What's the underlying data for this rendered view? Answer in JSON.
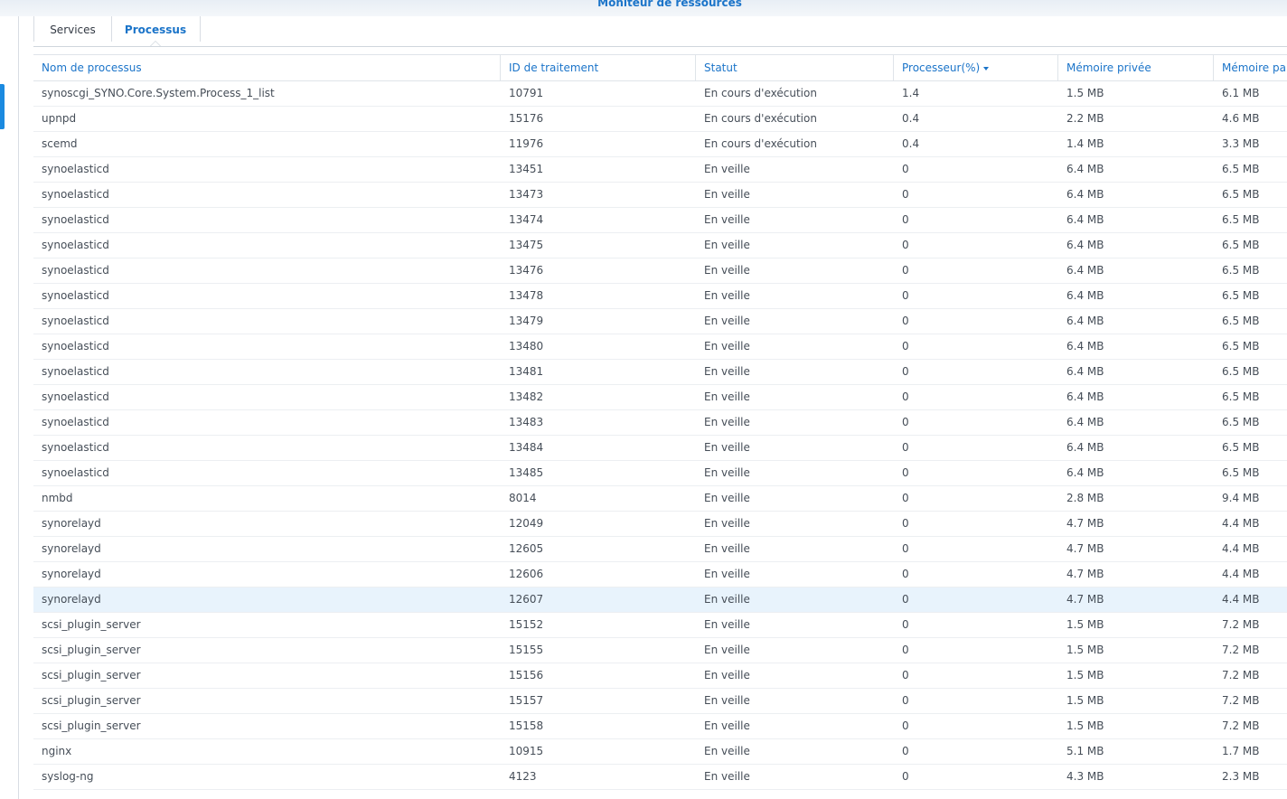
{
  "window": {
    "title": "Moniteur de ressources"
  },
  "tabs": [
    {
      "label": "Services",
      "active": false
    },
    {
      "label": "Processus",
      "active": true
    }
  ],
  "table": {
    "columns": [
      "Nom de processus",
      "ID de traitement",
      "Statut",
      "Processeur(%)",
      "Mémoire privée",
      "Mémoire pa"
    ],
    "sorted_column": "Processeur(%)",
    "sort_direction": "descending",
    "selected_row": 20,
    "rows": [
      [
        "synoscgi_SYNO.Core.System.Process_1_list",
        "10791",
        "En cours d'exécution",
        "1.4",
        "1.5 MB",
        "6.1 MB"
      ],
      [
        "upnpd",
        "15176",
        "En cours d'exécution",
        "0.4",
        "2.2 MB",
        "4.6 MB"
      ],
      [
        "scemd",
        "11976",
        "En cours d'exécution",
        "0.4",
        "1.4 MB",
        "3.3 MB"
      ],
      [
        "synoelasticd",
        "13451",
        "En veille",
        "0",
        "6.4 MB",
        "6.5 MB"
      ],
      [
        "synoelasticd",
        "13473",
        "En veille",
        "0",
        "6.4 MB",
        "6.5 MB"
      ],
      [
        "synoelasticd",
        "13474",
        "En veille",
        "0",
        "6.4 MB",
        "6.5 MB"
      ],
      [
        "synoelasticd",
        "13475",
        "En veille",
        "0",
        "6.4 MB",
        "6.5 MB"
      ],
      [
        "synoelasticd",
        "13476",
        "En veille",
        "0",
        "6.4 MB",
        "6.5 MB"
      ],
      [
        "synoelasticd",
        "13478",
        "En veille",
        "0",
        "6.4 MB",
        "6.5 MB"
      ],
      [
        "synoelasticd",
        "13479",
        "En veille",
        "0",
        "6.4 MB",
        "6.5 MB"
      ],
      [
        "synoelasticd",
        "13480",
        "En veille",
        "0",
        "6.4 MB",
        "6.5 MB"
      ],
      [
        "synoelasticd",
        "13481",
        "En veille",
        "0",
        "6.4 MB",
        "6.5 MB"
      ],
      [
        "synoelasticd",
        "13482",
        "En veille",
        "0",
        "6.4 MB",
        "6.5 MB"
      ],
      [
        "synoelasticd",
        "13483",
        "En veille",
        "0",
        "6.4 MB",
        "6.5 MB"
      ],
      [
        "synoelasticd",
        "13484",
        "En veille",
        "0",
        "6.4 MB",
        "6.5 MB"
      ],
      [
        "synoelasticd",
        "13485",
        "En veille",
        "0",
        "6.4 MB",
        "6.5 MB"
      ],
      [
        "nmbd",
        "8014",
        "En veille",
        "0",
        "2.8 MB",
        "9.4 MB"
      ],
      [
        "synorelayd",
        "12049",
        "En veille",
        "0",
        "4.7 MB",
        "4.4 MB"
      ],
      [
        "synorelayd",
        "12605",
        "En veille",
        "0",
        "4.7 MB",
        "4.4 MB"
      ],
      [
        "synorelayd",
        "12606",
        "En veille",
        "0",
        "4.7 MB",
        "4.4 MB"
      ],
      [
        "synorelayd",
        "12607",
        "En veille",
        "0",
        "4.7 MB",
        "4.4 MB"
      ],
      [
        "scsi_plugin_server",
        "15152",
        "En veille",
        "0",
        "1.5 MB",
        "7.2 MB"
      ],
      [
        "scsi_plugin_server",
        "15155",
        "En veille",
        "0",
        "1.5 MB",
        "7.2 MB"
      ],
      [
        "scsi_plugin_server",
        "15156",
        "En veille",
        "0",
        "1.5 MB",
        "7.2 MB"
      ],
      [
        "scsi_plugin_server",
        "15157",
        "En veille",
        "0",
        "1.5 MB",
        "7.2 MB"
      ],
      [
        "scsi_plugin_server",
        "15158",
        "En veille",
        "0",
        "1.5 MB",
        "7.2 MB"
      ],
      [
        "nginx",
        "10915",
        "En veille",
        "0",
        "5.1 MB",
        "1.7 MB"
      ],
      [
        "syslog-ng",
        "4123",
        "En veille",
        "0",
        "4.3 MB",
        "2.3 MB"
      ]
    ]
  },
  "colors": {
    "accent": "#1b74c9",
    "selected_row": "#e8f3fc",
    "sidebar_indicator": "#1b8ae0"
  }
}
